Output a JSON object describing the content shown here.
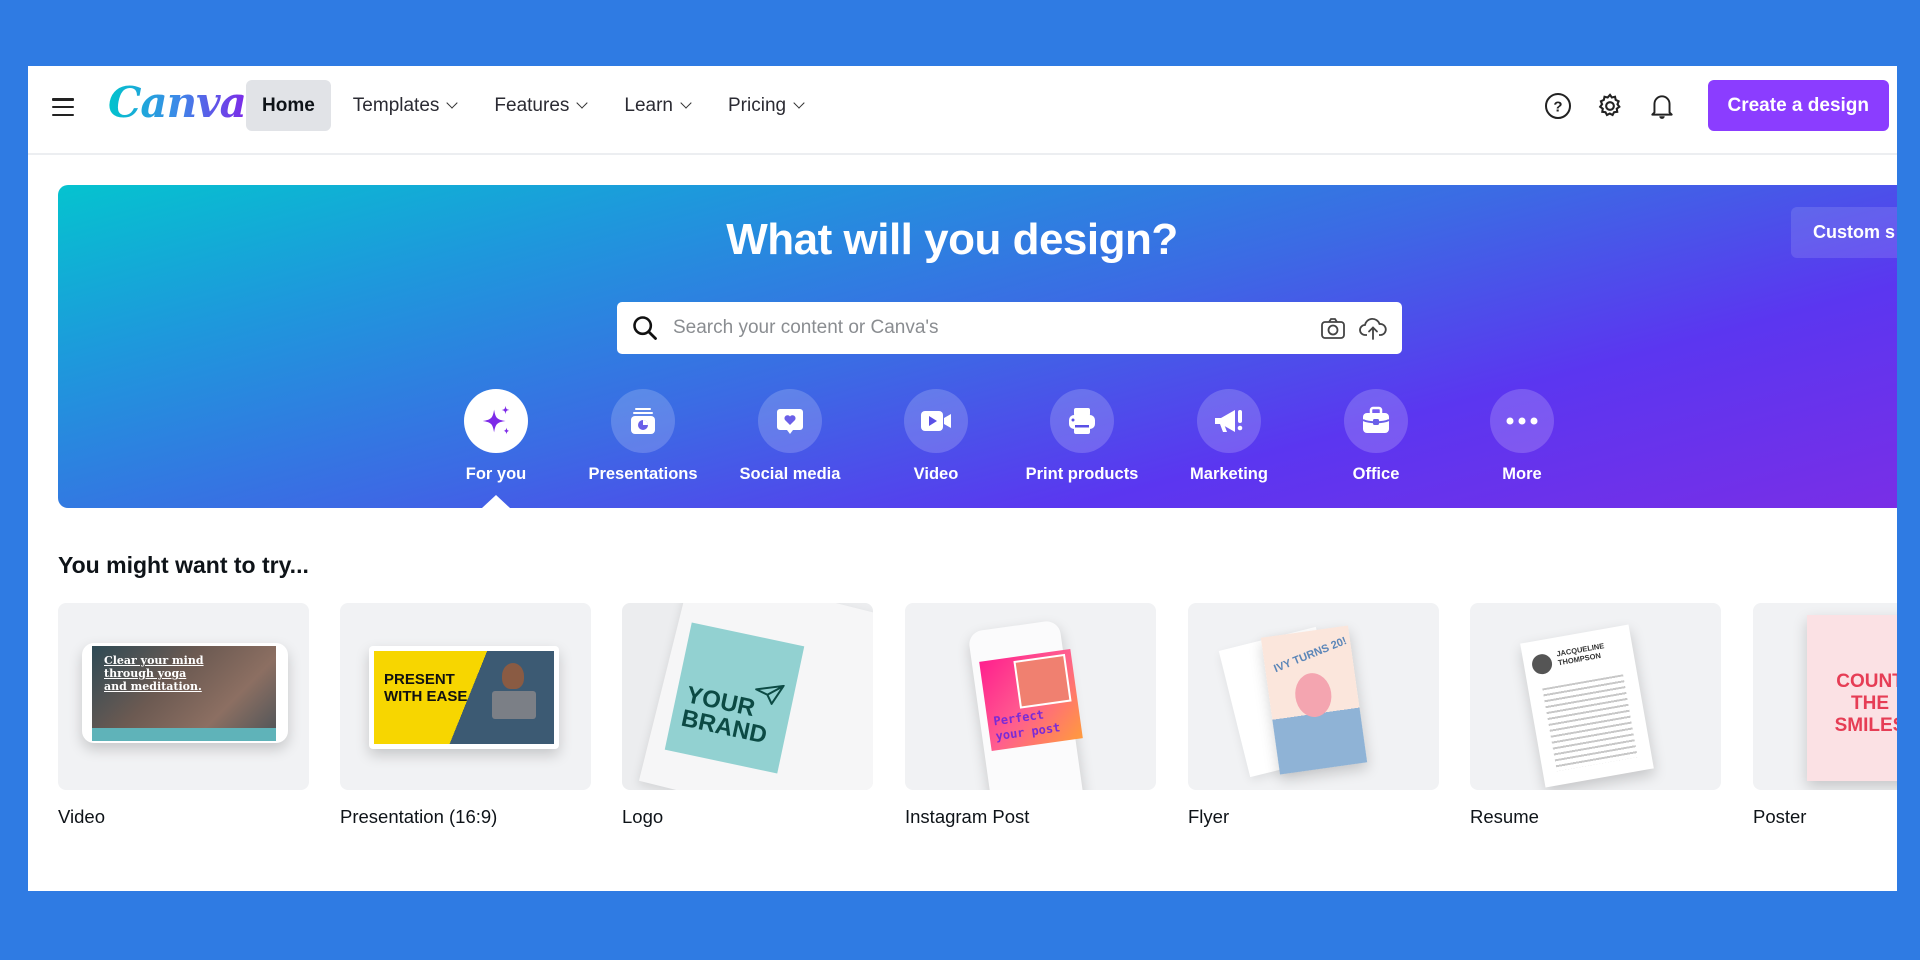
{
  "header": {
    "logo": "Canva",
    "nav": [
      {
        "label": "Home",
        "active": true,
        "dropdown": false
      },
      {
        "label": "Templates",
        "active": false,
        "dropdown": true
      },
      {
        "label": "Features",
        "active": false,
        "dropdown": true
      },
      {
        "label": "Learn",
        "active": false,
        "dropdown": true
      },
      {
        "label": "Pricing",
        "active": false,
        "dropdown": true
      }
    ],
    "icons": [
      "help-icon",
      "settings-icon",
      "notifications-icon"
    ],
    "create_button": "Create a design",
    "accent_color": "#8b3dff"
  },
  "hero": {
    "title": "What will you design?",
    "custom_size_button": "Custom s",
    "search": {
      "placeholder": "Search your content or Canva's",
      "value": ""
    },
    "categories": [
      {
        "label": "For you",
        "icon": "sparkle-icon",
        "active": true
      },
      {
        "label": "Presentations",
        "icon": "presentation-icon",
        "active": false
      },
      {
        "label": "Social media",
        "icon": "social-heart-icon",
        "active": false
      },
      {
        "label": "Video",
        "icon": "video-camera-icon",
        "active": false
      },
      {
        "label": "Print products",
        "icon": "printer-icon",
        "active": false
      },
      {
        "label": "Marketing",
        "icon": "megaphone-icon",
        "active": false
      },
      {
        "label": "Office",
        "icon": "briefcase-icon",
        "active": false
      },
      {
        "label": "More",
        "icon": "more-dots-icon",
        "active": false
      }
    ]
  },
  "suggestions": {
    "title": "You might want to try...",
    "items": [
      {
        "label": "Video",
        "thumb_text": "Clear your mind through yoga and meditation."
      },
      {
        "label": "Presentation (16:9)",
        "thumb_text": "PRESENT WITH EASE"
      },
      {
        "label": "Logo",
        "thumb_text": "YOUR BRAND"
      },
      {
        "label": "Instagram Post",
        "thumb_text": "Perfect your post"
      },
      {
        "label": "Flyer",
        "thumb_text": "IVY TURNS 20!"
      },
      {
        "label": "Resume",
        "thumb_text": "JACQUELINE THOMPSON"
      },
      {
        "label": "Poster",
        "thumb_text": "COUNT THE SMILES"
      }
    ]
  }
}
